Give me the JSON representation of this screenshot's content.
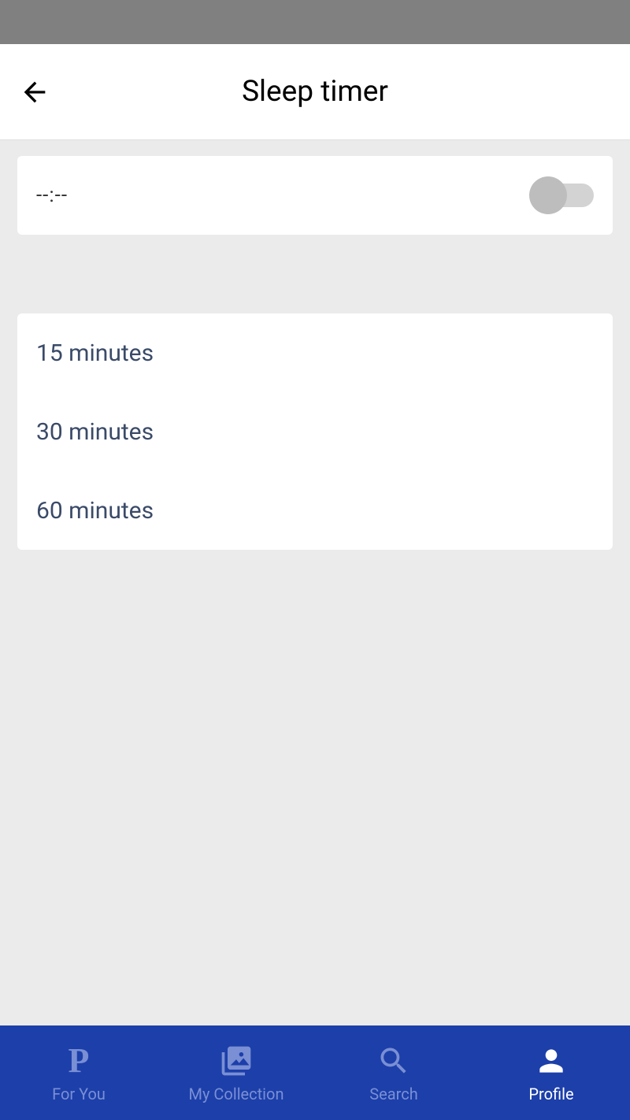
{
  "header": {
    "title": "Sleep timer"
  },
  "timer": {
    "display": "--:--",
    "enabled": false
  },
  "options": [
    {
      "label": "15 minutes"
    },
    {
      "label": "30 minutes"
    },
    {
      "label": "60 minutes"
    }
  ],
  "nav": {
    "for_you": "For You",
    "my_collection": "My Collection",
    "search": "Search",
    "profile": "Profile"
  }
}
